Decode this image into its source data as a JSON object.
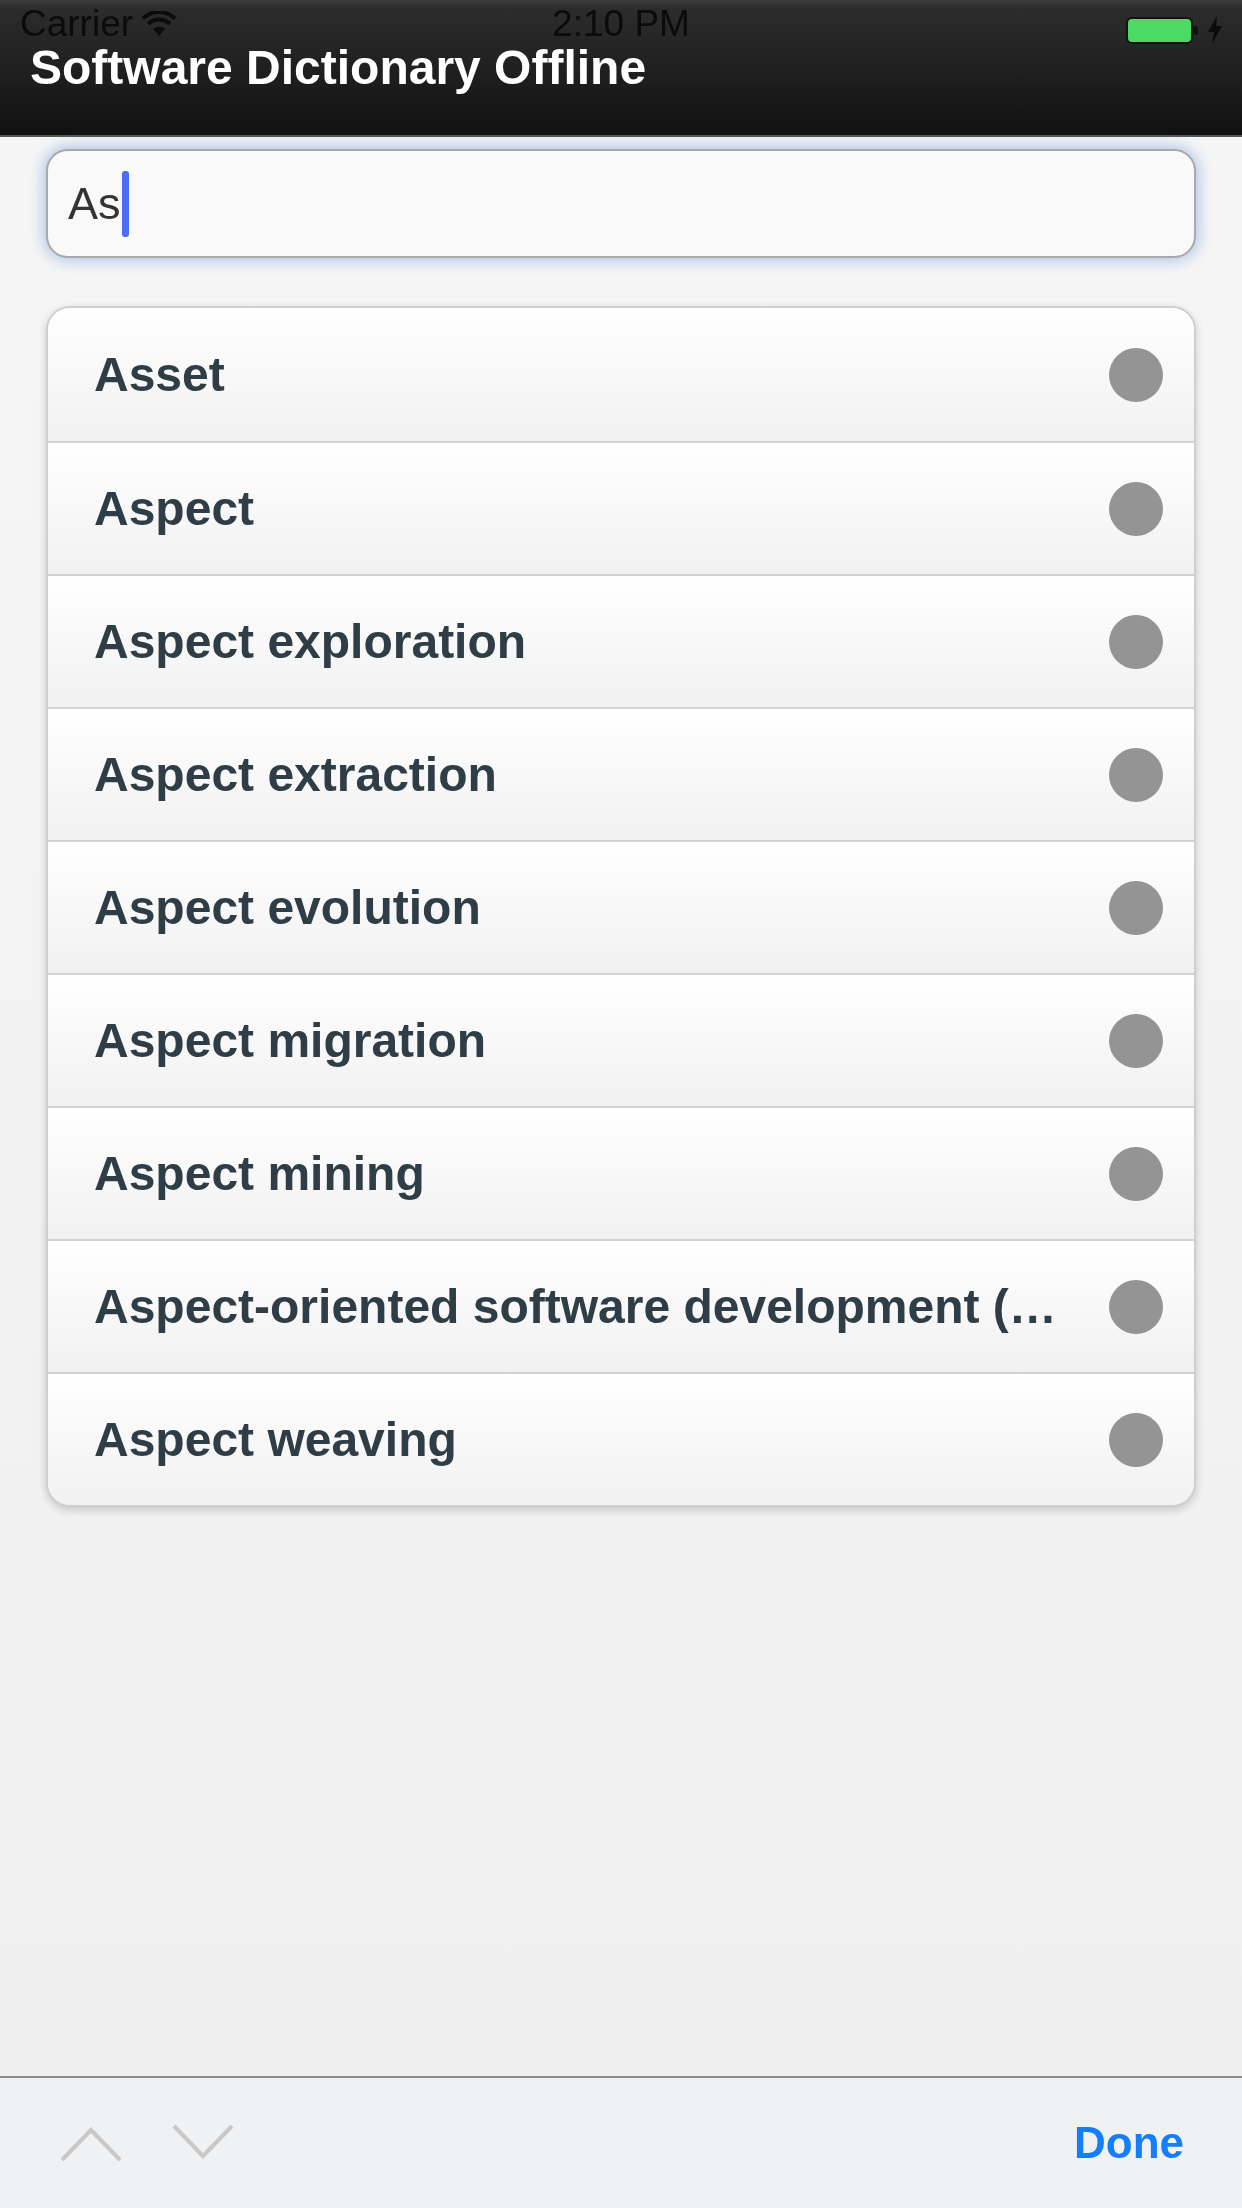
{
  "status_bar": {
    "carrier": "Carrier",
    "time": "2:10 PM",
    "charging": true
  },
  "navigation_bar": {
    "title": "Software Dictionary Offline"
  },
  "search": {
    "value": "As",
    "focused": true
  },
  "results": [
    {
      "term": "Asset"
    },
    {
      "term": "Aspect"
    },
    {
      "term": "Aspect exploration"
    },
    {
      "term": "Aspect extraction"
    },
    {
      "term": "Aspect evolution"
    },
    {
      "term": "Aspect migration"
    },
    {
      "term": "Aspect mining"
    },
    {
      "term": "Aspect-oriented software development (…"
    },
    {
      "term": "Aspect weaving"
    }
  ],
  "toolbar": {
    "buttons": [
      {
        "kind": "previous",
        "disabled": true
      },
      {
        "kind": "next",
        "disabled": true
      }
    ],
    "done": "Done"
  }
}
